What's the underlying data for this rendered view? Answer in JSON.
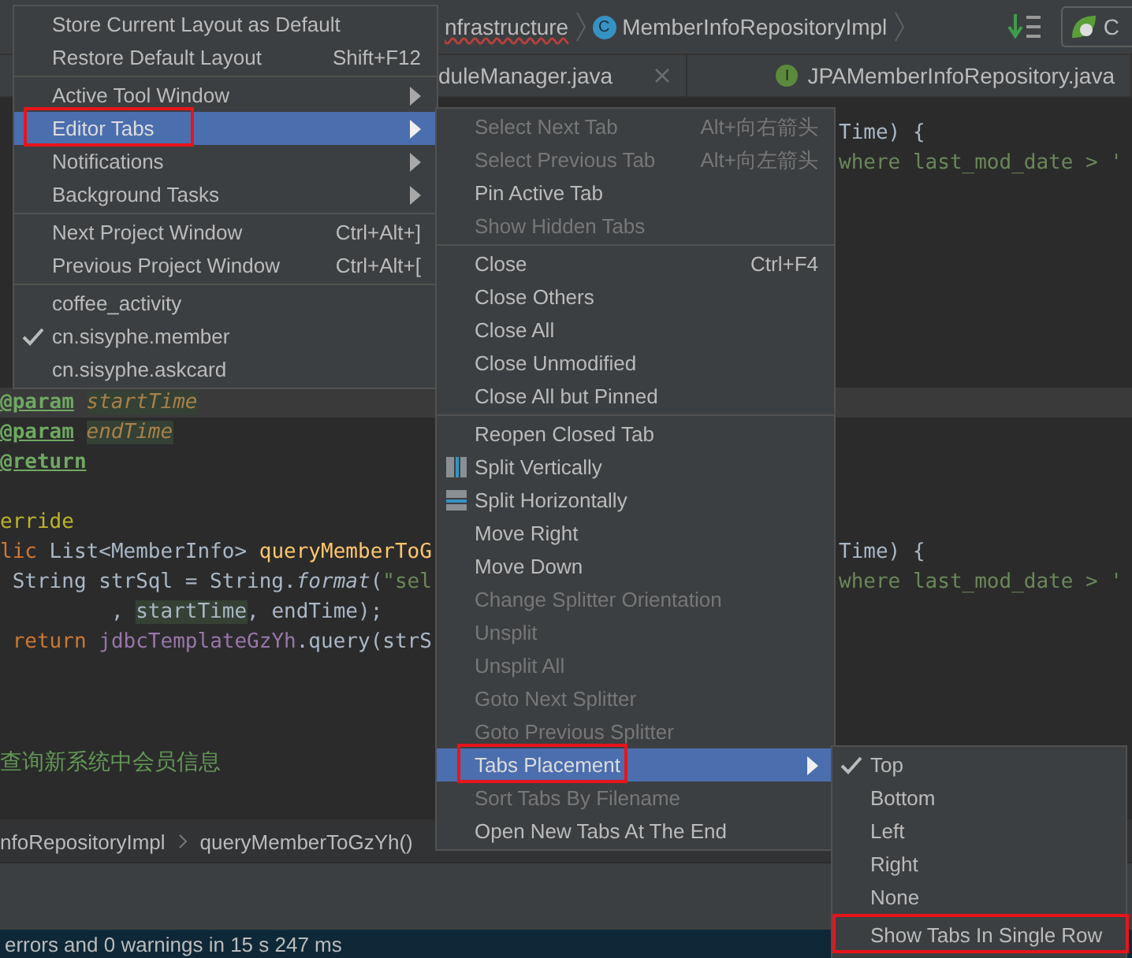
{
  "nav_bar": {
    "path": [
      {
        "text": "nfrastructure"
      },
      {
        "text": "MemberInfoRepositoryImpl",
        "badge": "C"
      }
    ],
    "run_config": "C"
  },
  "editor_tabs": [
    {
      "label": "duleManager.java",
      "closable": true,
      "selected": false
    },
    {
      "label": "JPAMemberInfoRepository.java",
      "badge": "I",
      "closable": false,
      "selected": false
    }
  ],
  "code_lines": [
    {
      "current": false,
      "right": [
        {
          "kind": "plain",
          "text": "Time) {"
        }
      ]
    },
    {
      "current": false,
      "right": [
        {
          "kind": "string",
          "text": "where last_mod_date > '"
        }
      ]
    },
    {
      "current": false
    },
    {
      "current": false
    },
    {
      "current": false
    },
    {
      "current": false
    },
    {
      "current": false
    },
    {
      "current": false
    },
    {
      "current": false
    },
    {
      "current": true,
      "left": [
        {
          "kind": "tag",
          "text": "@param"
        },
        {
          "kind": "param",
          "text": "startTime"
        }
      ]
    },
    {
      "current": false,
      "left": [
        {
          "kind": "tag",
          "text": "@param"
        },
        {
          "kind": "param",
          "text": "endTime"
        }
      ]
    },
    {
      "current": false,
      "left": [
        {
          "kind": "tag",
          "text": "@return"
        }
      ]
    },
    {
      "current": false
    },
    {
      "current": false,
      "left": [
        {
          "kind": "annotation",
          "text": "erride"
        }
      ]
    },
    {
      "current": false,
      "left": [
        {
          "kind": "keyword",
          "text": "lic"
        },
        {
          "kind": "plain",
          "text": " List<MemberInfo> "
        },
        {
          "kind": "method",
          "text": "queryMemberToG"
        }
      ],
      "right": [
        {
          "kind": "plain",
          "text": "Time) {"
        }
      ]
    },
    {
      "current": false,
      "left": [
        {
          "kind": "plain",
          "text": " String strSql = String."
        },
        {
          "kind": "static",
          "text": "format"
        },
        {
          "kind": "plain",
          "text": "("
        },
        {
          "kind": "string",
          "text": "\"sel"
        }
      ],
      "right": [
        {
          "kind": "string",
          "text": "where last_mod_date > '"
        }
      ]
    },
    {
      "current": false,
      "left": [
        {
          "kind": "plain",
          "text": "         , "
        },
        {
          "kind": "usage",
          "text": "startTime"
        },
        {
          "kind": "plain",
          "text": ", endTime);"
        }
      ]
    },
    {
      "current": false,
      "left": [
        {
          "kind": "keyword",
          "text": " return "
        },
        {
          "kind": "field",
          "text": "jdbcTemplateGzYh"
        },
        {
          "kind": "plain",
          "text": ".query(strS"
        }
      ]
    },
    {
      "current": false
    },
    {
      "current": false
    },
    {
      "current": false
    },
    {
      "current": false,
      "left": [
        {
          "kind": "comment",
          "text": "查询新系统中会员信息"
        }
      ]
    }
  ],
  "breadcrumbs": [
    "nfoRepositoryImpl",
    "queryMemberToGzYh()"
  ],
  "status_bar": "errors and 0 warnings in 15 s 247 ms",
  "window_menu": [
    [
      {
        "label": "Store Current Layout as Default",
        "selected": false
      },
      {
        "label": "Restore Default Layout",
        "shortcut": "Shift+F12",
        "selected": false
      }
    ],
    [
      {
        "label": "Active Tool Window",
        "submenu": true,
        "selected": false
      },
      {
        "label": "Editor Tabs",
        "submenu": true,
        "selected": true,
        "annotated": true
      },
      {
        "label": "Notifications",
        "submenu": true,
        "selected": false
      },
      {
        "label": "Background Tasks",
        "submenu": true,
        "selected": false
      }
    ],
    [
      {
        "label": "Next Project Window",
        "shortcut": "Ctrl+Alt+]",
        "selected": false
      },
      {
        "label": "Previous Project Window",
        "shortcut": "Ctrl+Alt+[",
        "selected": false
      }
    ],
    [
      {
        "label": "coffee_activity",
        "checked": false,
        "selected": false
      },
      {
        "label": "cn.sisyphe.member",
        "checked": true,
        "selected": false
      },
      {
        "label": "cn.sisyphe.askcard",
        "checked": false,
        "selected": false
      }
    ]
  ],
  "editor_tabs_menu": [
    [
      {
        "label": "Select Next Tab",
        "shortcut": "Alt+向右箭头",
        "disabled": true,
        "selected": false
      },
      {
        "label": "Select Previous Tab",
        "shortcut": "Alt+向左箭头",
        "disabled": true,
        "selected": false
      },
      {
        "label": "Pin Active Tab",
        "disabled": false,
        "selected": false
      },
      {
        "label": "Show Hidden Tabs",
        "disabled": true,
        "selected": false
      }
    ],
    [
      {
        "label": "Close",
        "shortcut": "Ctrl+F4",
        "disabled": false,
        "selected": false
      },
      {
        "label": "Close Others",
        "disabled": false,
        "selected": false
      },
      {
        "label": "Close All",
        "disabled": false,
        "selected": false
      },
      {
        "label": "Close Unmodified",
        "disabled": false,
        "selected": false
      },
      {
        "label": "Close All but Pinned",
        "disabled": false,
        "selected": false
      }
    ],
    [
      {
        "label": "Reopen Closed Tab",
        "disabled": false,
        "selected": false
      },
      {
        "label": "Split Vertically",
        "disabled": false,
        "selected": false
      },
      {
        "label": "Split Horizontally",
        "disabled": false,
        "selected": false
      },
      {
        "label": "Move Right",
        "disabled": false,
        "selected": false
      },
      {
        "label": "Move Down",
        "disabled": false,
        "selected": false
      },
      {
        "label": "Change Splitter Orientation",
        "disabled": true,
        "selected": false
      },
      {
        "label": "Unsplit",
        "disabled": true,
        "selected": false
      },
      {
        "label": "Unsplit All",
        "disabled": true,
        "selected": false
      },
      {
        "label": "Goto Next Splitter",
        "disabled": true,
        "selected": false
      },
      {
        "label": "Goto Previous Splitter",
        "disabled": true,
        "selected": false
      },
      {
        "label": "Tabs Placement",
        "submenu": true,
        "disabled": false,
        "selected": true,
        "annotated": true
      },
      {
        "label": "Sort Tabs By Filename",
        "disabled": true,
        "selected": false
      },
      {
        "label": "Open New Tabs At The End",
        "disabled": false,
        "selected": false
      }
    ]
  ],
  "tabs_placement_menu": [
    [
      {
        "label": "Top",
        "checked": true,
        "selected": false
      },
      {
        "label": "Bottom",
        "checked": false,
        "selected": false
      },
      {
        "label": "Left",
        "checked": false,
        "selected": false
      },
      {
        "label": "Right",
        "checked": false,
        "selected": false
      },
      {
        "label": "None",
        "checked": false,
        "selected": false
      }
    ],
    [
      {
        "label": "Show Tabs In Single Row",
        "checked": false,
        "selected": false,
        "annotated": true
      }
    ]
  ]
}
